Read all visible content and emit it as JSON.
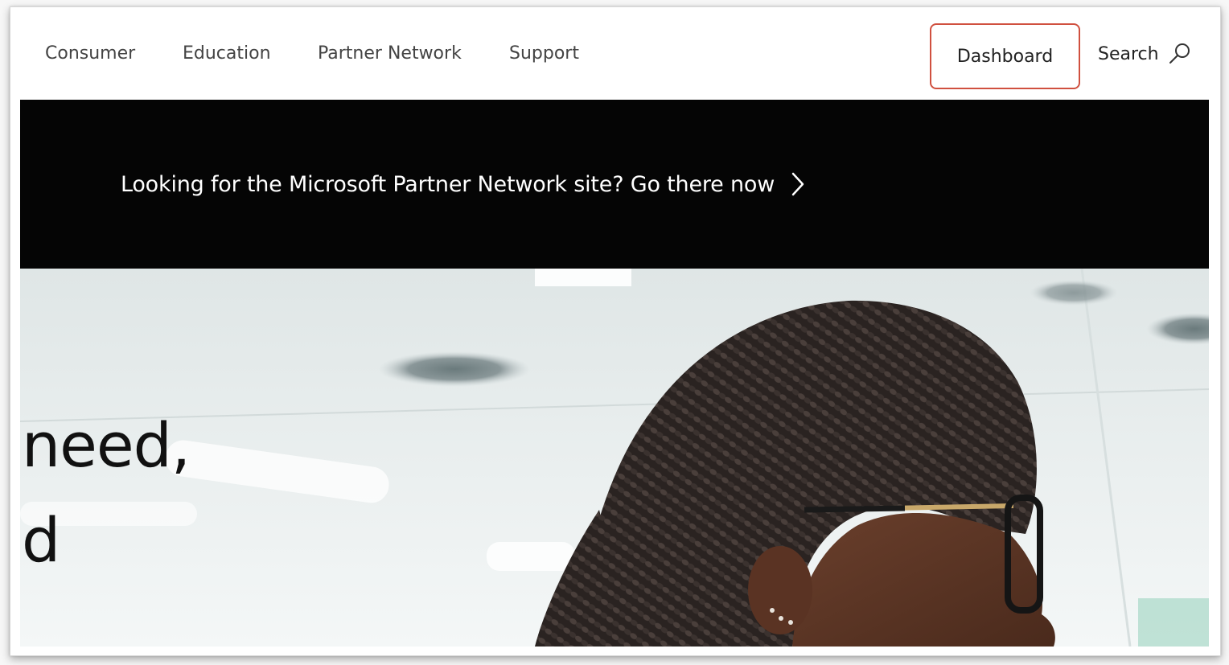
{
  "nav": {
    "items": [
      {
        "label": "Consumer"
      },
      {
        "label": "Education"
      },
      {
        "label": "Partner Network"
      },
      {
        "label": "Support"
      }
    ],
    "dashboard_label": "Dashboard",
    "search_label": "Search",
    "highlight_color": "#d0503f"
  },
  "banner": {
    "text": "Looking for the Microsoft Partner Network site? Go there now",
    "background_color": "#050505"
  },
  "hero": {
    "heading_lines": [
      "need,",
      "d"
    ],
    "image_description_icon": "person-with-braids-and-glasses-photo"
  }
}
